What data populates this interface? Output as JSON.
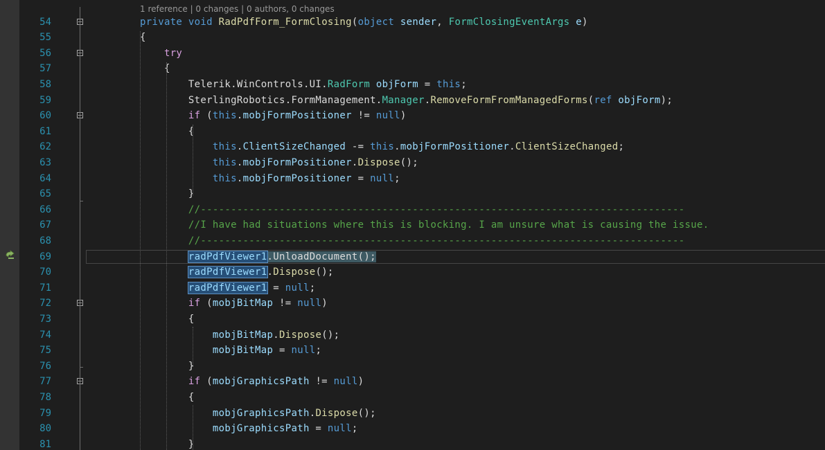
{
  "codelens": "1 reference | 0 changes | 0 authors, 0 changes",
  "current_line": 69,
  "lines": [
    {
      "n": "54",
      "tokens": [
        [
          "kw",
          "private"
        ],
        [
          "",
          "&#32;"
        ],
        [
          "kw",
          "void"
        ],
        [
          "",
          ""
        ],
        [
          "fn",
          "RadPdfForm_FormClosing"
        ],
        [
          "",
          "("
        ],
        [
          "kw",
          "object"
        ],
        [
          "",
          ""
        ],
        [
          "id",
          "sender"
        ],
        [
          "",
          ", "
        ],
        [
          "ty",
          "FormClosingEventArgs"
        ],
        [
          "",
          ""
        ],
        [
          "id",
          "e"
        ],
        [
          "",
          ")"
        ]
      ]
    },
    {
      "n": "55",
      "tokens": [
        [
          "",
          "{"
        ]
      ]
    },
    {
      "n": "56",
      "tokens": [
        [
          "ctl",
          "    try"
        ]
      ]
    },
    {
      "n": "57",
      "tokens": [
        [
          "",
          "    {"
        ]
      ]
    },
    {
      "n": "58",
      "tokens": [
        [
          "",
          "        Telerik.WinControls.UI."
        ],
        [
          "ty",
          "RadForm"
        ],
        [
          "",
          ""
        ],
        [
          "id",
          "objForm"
        ],
        [
          "",
          " = "
        ],
        [
          "kw",
          "this"
        ],
        [
          "",
          ";"
        ]
      ]
    },
    {
      "n": "59",
      "tokens": [
        [
          "",
          "        SterlingRobotics.FormManagement."
        ],
        [
          "ty",
          "Manager"
        ],
        [
          "",
          "."
        ],
        [
          "fn",
          "RemoveFormFromManagedForms"
        ],
        [
          "",
          "("
        ],
        [
          "kw",
          "ref"
        ],
        [
          "",
          ""
        ],
        [
          "id",
          "objForm"
        ],
        [
          "",
          ");"
        ]
      ]
    },
    {
      "n": "60",
      "tokens": [
        [
          "ctl",
          "        if"
        ],
        [
          "",
          " ("
        ],
        [
          "kw",
          "this"
        ],
        [
          "",
          "."
        ],
        [
          "id",
          "mobjFormPositioner"
        ],
        [
          "",
          " != "
        ],
        [
          "kw",
          "null"
        ],
        [
          "",
          ")"
        ]
      ]
    },
    {
      "n": "61",
      "tokens": [
        [
          "",
          "        {"
        ]
      ]
    },
    {
      "n": "62",
      "tokens": [
        [
          "kw",
          "            this"
        ],
        [
          "",
          "."
        ],
        [
          "id",
          "ClientSizeChanged"
        ],
        [
          "",
          " -= "
        ],
        [
          "kw",
          "this"
        ],
        [
          "",
          "."
        ],
        [
          "id",
          "mobjFormPositioner"
        ],
        [
          "",
          "."
        ],
        [
          "fn",
          "ClientSizeChanged"
        ],
        [
          "",
          ";"
        ]
      ]
    },
    {
      "n": "63",
      "tokens": [
        [
          "kw",
          "            this"
        ],
        [
          "",
          "."
        ],
        [
          "id",
          "mobjFormPositioner"
        ],
        [
          "",
          "."
        ],
        [
          "fn",
          "Dispose"
        ],
        [
          "",
          "();"
        ]
      ]
    },
    {
      "n": "64",
      "tokens": [
        [
          "kw",
          "            this"
        ],
        [
          "",
          "."
        ],
        [
          "id",
          "mobjFormPositioner"
        ],
        [
          "",
          " = "
        ],
        [
          "kw",
          "null"
        ],
        [
          "",
          ";"
        ]
      ]
    },
    {
      "n": "65",
      "tokens": [
        [
          "",
          "        }"
        ]
      ]
    },
    {
      "n": "66",
      "tokens": [
        [
          "cm",
          "        //--------------------------------------------------------------------------------"
        ]
      ]
    },
    {
      "n": "67",
      "tokens": [
        [
          "cm",
          "        //I have had situations where this is blocking. I am unsure what is causing the issue."
        ]
      ]
    },
    {
      "n": "68",
      "tokens": [
        [
          "cm",
          "        //--------------------------------------------------------------------------------"
        ]
      ]
    },
    {
      "n": "69",
      "tokens": [
        [
          "",
          "        "
        ],
        [
          "sel",
          "radPdfViewer1"
        ],
        [
          "hl",
          "."
        ],
        [
          "hl",
          "UnloadDocument"
        ],
        [
          "hl",
          "();"
        ]
      ]
    },
    {
      "n": "70",
      "tokens": [
        [
          "",
          "        "
        ],
        [
          "sel",
          "radPdfViewer1"
        ],
        [
          "",
          "."
        ],
        [
          "fn",
          "Dispose"
        ],
        [
          "",
          "();"
        ]
      ]
    },
    {
      "n": "71",
      "tokens": [
        [
          "",
          "        "
        ],
        [
          "sel",
          "radPdfViewer1"
        ],
        [
          "",
          " = "
        ],
        [
          "kw",
          "null"
        ],
        [
          "",
          ";"
        ]
      ]
    },
    {
      "n": "72",
      "tokens": [
        [
          "ctl",
          "        if"
        ],
        [
          "",
          " ("
        ],
        [
          "id",
          "mobjBitMap"
        ],
        [
          "",
          " != "
        ],
        [
          "kw",
          "null"
        ],
        [
          "",
          ")"
        ]
      ]
    },
    {
      "n": "73",
      "tokens": [
        [
          "",
          "        {"
        ]
      ]
    },
    {
      "n": "74",
      "tokens": [
        [
          "id",
          "            mobjBitMap"
        ],
        [
          "",
          "."
        ],
        [
          "fn",
          "Dispose"
        ],
        [
          "",
          "();"
        ]
      ]
    },
    {
      "n": "75",
      "tokens": [
        [
          "id",
          "            mobjBitMap"
        ],
        [
          "",
          " = "
        ],
        [
          "kw",
          "null"
        ],
        [
          "",
          ";"
        ]
      ]
    },
    {
      "n": "76",
      "tokens": [
        [
          "",
          "        }"
        ]
      ]
    },
    {
      "n": "77",
      "tokens": [
        [
          "ctl",
          "        if"
        ],
        [
          "",
          " ("
        ],
        [
          "id",
          "mobjGraphicsPath"
        ],
        [
          "",
          " != "
        ],
        [
          "kw",
          "null"
        ],
        [
          "",
          ")"
        ]
      ]
    },
    {
      "n": "78",
      "tokens": [
        [
          "",
          "        {"
        ]
      ]
    },
    {
      "n": "79",
      "tokens": [
        [
          "id",
          "            mobjGraphicsPath"
        ],
        [
          "",
          "."
        ],
        [
          "fn",
          "Dispose"
        ],
        [
          "",
          "();"
        ]
      ]
    },
    {
      "n": "80",
      "tokens": [
        [
          "id",
          "            mobjGraphicsPath"
        ],
        [
          "",
          " = "
        ],
        [
          "kw",
          "null"
        ],
        [
          "",
          ";"
        ]
      ]
    },
    {
      "n": "81",
      "tokens": [
        [
          "",
          "        }"
        ]
      ]
    }
  ],
  "fold_lines": [
    "54",
    "56",
    "60",
    "72",
    "77"
  ],
  "icons": {
    "margin_arrow": "next-statement-arrow-icon",
    "fold": "collapse-region-icon"
  }
}
